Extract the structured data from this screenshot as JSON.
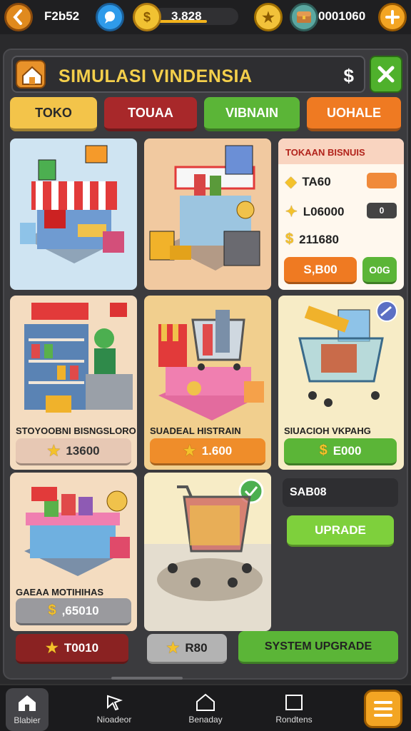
{
  "topbar": {
    "player_label": "F2b52",
    "coins_value": "3.828",
    "gems_value": "0001060"
  },
  "header": {
    "title": "SIMULASI VINDENSIA",
    "currency_symbol": "$"
  },
  "tabs": [
    {
      "label": "TOKO"
    },
    {
      "label": "TOUAA"
    },
    {
      "label": "VIBNAIN"
    },
    {
      "label": "UOHALE"
    }
  ],
  "info_card": {
    "title": "TOKAAN BISNUIS",
    "rows": [
      {
        "label": "TA60",
        "chip_color": "#f08a3a"
      },
      {
        "label": "L06000",
        "chip_color": "#444444",
        "chip": "0"
      },
      {
        "label": "211680"
      }
    ],
    "buy_label": "S,B00",
    "go_label": "O0G"
  },
  "cards": {
    "card_a": {
      "label": "STOYOOBNI BISNGSLORO",
      "price": "13600"
    },
    "card_b": {
      "label": "SUADEAL HISTRAIN",
      "price": "1.600"
    },
    "card_c": {
      "label": "SIUACIOH VKPAHG",
      "price": "E000"
    },
    "card_d": {
      "label": "GAEAA MOTIHIHAS",
      "price": ",65010"
    }
  },
  "side_value": "SAB08",
  "upgrade_label": "UPRADE",
  "bottom_row": {
    "price_1": "T0010",
    "price_2": "R80",
    "system_upgrade": "SYSTEM UPGRADE"
  },
  "nav": [
    {
      "label": "Blabier"
    },
    {
      "label": "Nioadeor"
    },
    {
      "label": "Benaday"
    },
    {
      "label": "Rondtens"
    }
  ],
  "colors": {
    "accent_orange": "#f3a523",
    "accent_green": "#5bb537",
    "accent_red": "#a8282a",
    "title_yellow": "#f4cf4b"
  }
}
